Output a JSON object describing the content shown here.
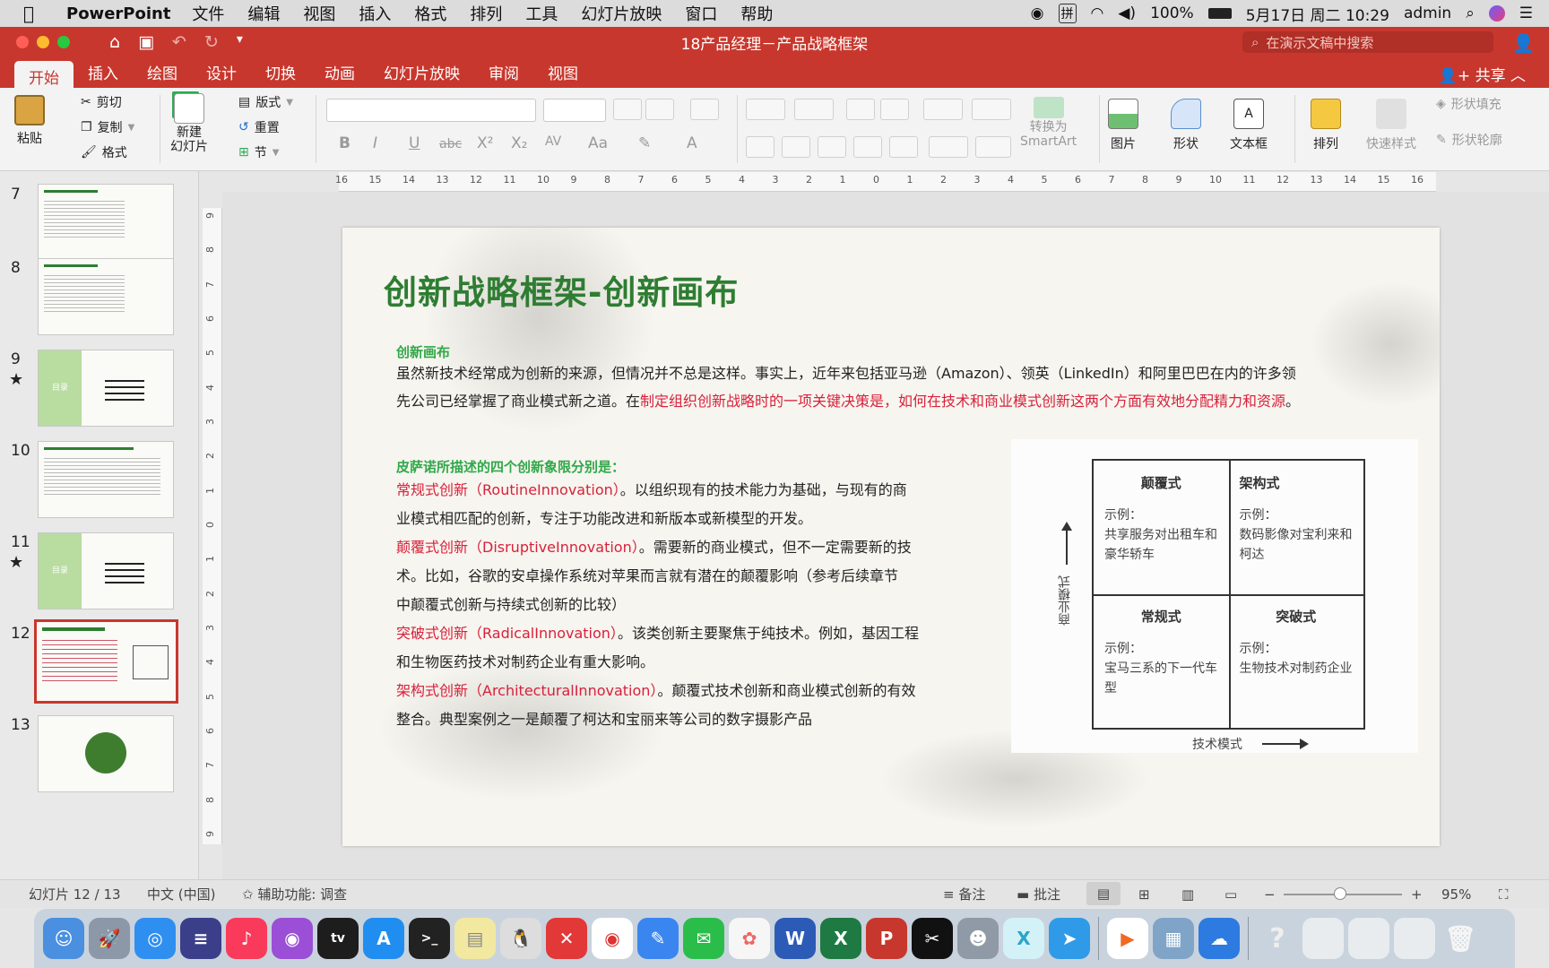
{
  "menubar": {
    "app_name": "PowerPoint",
    "items": [
      "文件",
      "编辑",
      "视图",
      "插入",
      "格式",
      "排列",
      "工具",
      "幻灯片放映",
      "窗口",
      "帮助"
    ],
    "battery": "100%",
    "datetime": "5月17日 周二 10:29",
    "user": "admin"
  },
  "titlebar": {
    "doc_title": "18产品经理－产品战略框架",
    "search_placeholder": "在演示文稿中搜索"
  },
  "tabs": [
    "开始",
    "插入",
    "绘图",
    "设计",
    "切换",
    "动画",
    "幻灯片放映",
    "审阅",
    "视图"
  ],
  "active_tab": "开始",
  "share_label": "共享",
  "ribbon": {
    "paste": "粘贴",
    "cut": "剪切",
    "copy": "复制",
    "format": "格式",
    "new_slide": "新建\n幻灯片",
    "layout": "版式",
    "reset": "重置",
    "section": "节",
    "convert_smartart": "转换为\nSmartArt",
    "picture": "图片",
    "shape": "形状",
    "textbox": "文本框",
    "arrange": "排列",
    "quick_styles": "快速样式",
    "shape_fill": "形状填充",
    "shape_outline": "形状轮廓"
  },
  "thumbnails": [
    {
      "num": "7",
      "star": false
    },
    {
      "num": "8",
      "star": false
    },
    {
      "num": "9",
      "star": true,
      "label": "目录"
    },
    {
      "num": "10",
      "star": false
    },
    {
      "num": "11",
      "star": true,
      "label": "目录"
    },
    {
      "num": "12",
      "star": false,
      "selected": true
    },
    {
      "num": "13",
      "star": false
    }
  ],
  "ruler_h": [
    "16",
    "15",
    "14",
    "13",
    "12",
    "11",
    "10",
    "9",
    "8",
    "7",
    "6",
    "5",
    "4",
    "3",
    "2",
    "1",
    "0",
    "1",
    "2",
    "3",
    "4",
    "5",
    "6",
    "7",
    "8",
    "9",
    "10",
    "11",
    "12",
    "13",
    "14",
    "15",
    "16"
  ],
  "ruler_v": [
    "9",
    "8",
    "7",
    "6",
    "5",
    "4",
    "3",
    "2",
    "1",
    "0",
    "1",
    "2",
    "3",
    "4",
    "5",
    "6",
    "7",
    "8",
    "9"
  ],
  "slide": {
    "title": "创新战略框架-创新画布",
    "section1_heading": "创新画布",
    "p1_a": "虽然新技术经常成为创新的来源，但情况并不总是这样。事实上，近年来包括亚马逊（Amazon）、领英（LinkedIn）和阿里巴巴在内的许多领",
    "p1_b_plain": "先公司已经掌握了商业模式新之道。在",
    "p1_b_red": "制定组织创新战略时的一项关键决策是，如何在技术和商业模式创新这两个方面有效地分配精力和资源",
    "p1_b_end": "。",
    "section2_heading": "皮萨诺所描述的四个创新象限分别是：",
    "items": [
      {
        "red": "常规式创新（RoutineInnovation）",
        "text1": "。以组织现有的技术能力为基础，与现有的商",
        "text2": "业模式相匹配的创新，专注于功能改进和新版本或新模型的开发。",
        "text3": ""
      },
      {
        "red": "颠覆式创新（DisruptiveInnovation）",
        "text1": "。需要新的商业模式，但不一定需要新的技",
        "text2": "术。比如，谷歌的安卓操作系统对苹果而言就有潜在的颠覆影响（参考后续章节",
        "text3": "中颠覆式创新与持续式创新的比较）"
      },
      {
        "red": "突破式创新（RadicalInnovation）",
        "text1": "。该类创新主要聚焦于纯技术。例如，基因工程",
        "text2": "和生物医药技术对制药企业有重大影响。",
        "text3": ""
      },
      {
        "red": "架构式创新（ArchitecturalInnovation）",
        "text1": "。颠覆式技术创新和商业模式创新的有效",
        "text2": "整合。典型案例之一是颠覆了柯达和宝丽来等公司的数字摄影产品",
        "text3": ""
      }
    ],
    "matrix": {
      "y_axis_label": "商业模式",
      "x_axis_label": "技术模式",
      "cells": [
        {
          "title": "颠覆式",
          "example_label": "示例：",
          "example": "共享服务对出租车和豪华轿车"
        },
        {
          "title": "架构式",
          "example_label": "示例：",
          "example": "数码影像对宝利来和柯达"
        },
        {
          "title": "常规式",
          "example_label": "示例：",
          "example": "宝马三系的下一代车型"
        },
        {
          "title": "突破式",
          "example_label": "示例：",
          "example": "生物技术对制药企业"
        }
      ]
    }
  },
  "statusbar": {
    "slide_pos": "幻灯片 12 / 13",
    "language": "中文 (中国)",
    "accessibility": "辅助功能: 调查",
    "notes": "备注",
    "comments": "批注",
    "zoom": "95%"
  },
  "colors": {
    "accent": "#c8372d",
    "title_green": "#2e7d32",
    "heading_green": "#31a84a",
    "highlight_red": "#d9213b"
  }
}
